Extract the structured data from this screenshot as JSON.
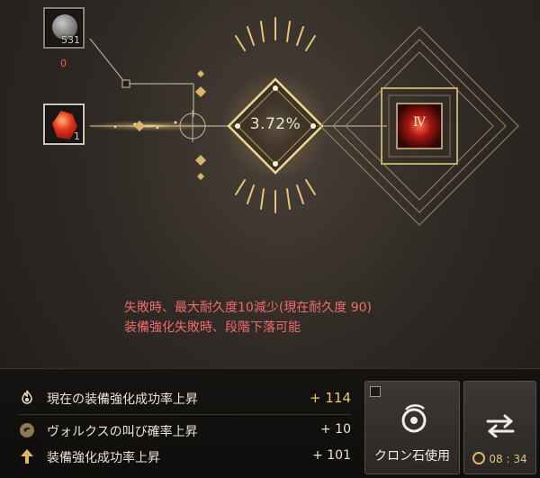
{
  "items": {
    "material": {
      "icon": "moon-stone-icon",
      "count": "531",
      "needed": "0"
    },
    "crystal": {
      "icon": "red-crystal-icon",
      "count": "1"
    }
  },
  "enhance": {
    "success_rate": "3.72%",
    "target_grade": "Ⅳ"
  },
  "warnings": [
    "失敗時、最大耐久度10減少(現在耐久度 90)",
    "装備強化失敗時、段階下落可能"
  ],
  "stats": {
    "current": {
      "label": "現在の装備強化成功率上昇",
      "value": "+ 114"
    },
    "volks": {
      "label": "ヴォルクスの叫び確率上昇",
      "value": "+ 10"
    },
    "enhance": {
      "label": "装備強化成功率上昇",
      "value": "+ 101"
    }
  },
  "buttons": {
    "cron": {
      "label": "クロン石使用",
      "checked": false
    },
    "swap": {
      "timer": "08 : 34"
    }
  },
  "colors": {
    "gold": "#d9b46a",
    "warning": "#f26a6a",
    "value_highlight": "#f0c96a"
  }
}
